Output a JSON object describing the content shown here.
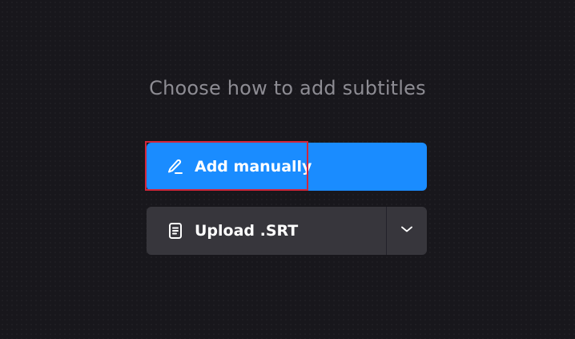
{
  "heading": "Choose how to add subtitles",
  "buttons": {
    "add_manually": {
      "label": "Add manually",
      "icon": "pencil-icon",
      "color": "#1a8cff"
    },
    "upload_srt": {
      "label": "Upload .SRT",
      "icon": "document-icon",
      "dropdown_icon": "chevron-down-icon",
      "color": "#37363c"
    }
  },
  "highlight_color": "#d3263a"
}
